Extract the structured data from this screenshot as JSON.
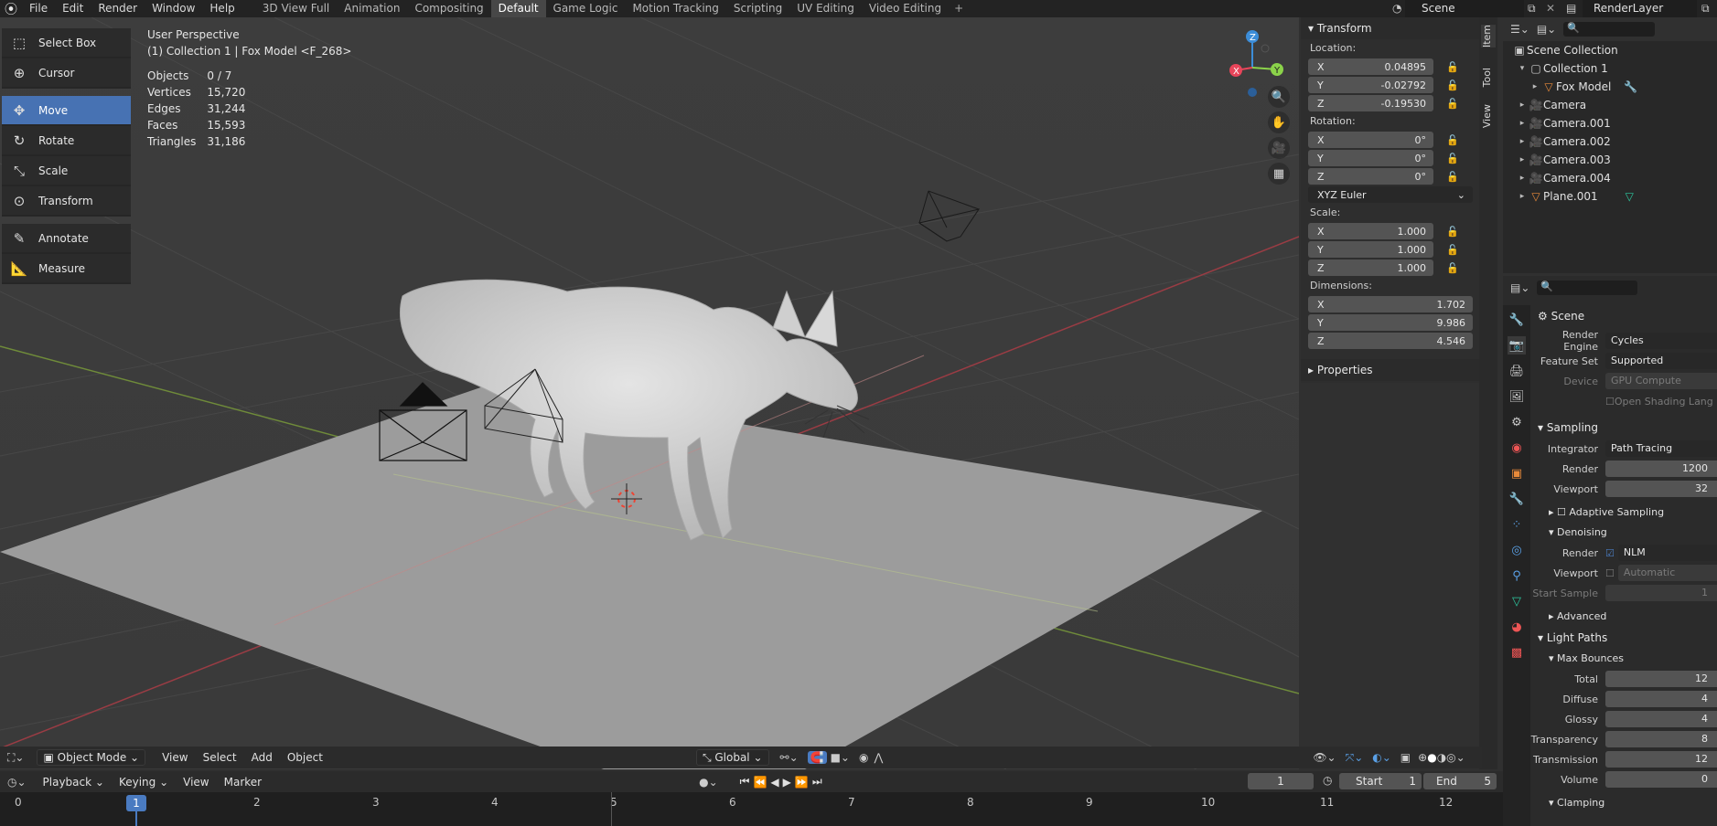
{
  "menu": [
    "File",
    "Edit",
    "Render",
    "Window",
    "Help"
  ],
  "workspaces": [
    "3D View Full",
    "Animation",
    "Compositing",
    "Default",
    "Game Logic",
    "Motion Tracking",
    "Scripting",
    "UV Editing",
    "Video Editing"
  ],
  "active_workspace": "Default",
  "scene_name": "Scene",
  "render_layer": "RenderLayer",
  "toolbar": [
    "Select Box",
    "Cursor",
    "Move",
    "Rotate",
    "Scale",
    "Transform",
    "Annotate",
    "Measure"
  ],
  "active_tool": "Move",
  "viewport": {
    "view_name": "User Perspective",
    "object_info": "(1) Collection 1 | Fox Model <F_268>",
    "stats": [
      {
        "label": "Objects",
        "value": "0 / 7"
      },
      {
        "label": "Vertices",
        "value": "15,720"
      },
      {
        "label": "Edges",
        "value": "31,244"
      },
      {
        "label": "Faces",
        "value": "15,593"
      },
      {
        "label": "Triangles",
        "value": "31,186"
      }
    ]
  },
  "npanel": {
    "transform_title": "Transform",
    "location_label": "Location:",
    "location": [
      {
        "axis": "X",
        "value": "0.04895"
      },
      {
        "axis": "Y",
        "value": "-0.02792"
      },
      {
        "axis": "Z",
        "value": "-0.19530"
      }
    ],
    "rotation_label": "Rotation:",
    "rotation": [
      {
        "axis": "X",
        "value": "0°"
      },
      {
        "axis": "Y",
        "value": "0°"
      },
      {
        "axis": "Z",
        "value": "0°"
      }
    ],
    "rotation_mode": "XYZ Euler",
    "scale_label": "Scale:",
    "scale": [
      {
        "axis": "X",
        "value": "1.000"
      },
      {
        "axis": "Y",
        "value": "1.000"
      },
      {
        "axis": "Z",
        "value": "1.000"
      }
    ],
    "dimensions_label": "Dimensions:",
    "dimensions": [
      {
        "axis": "X",
        "value": "1.702"
      },
      {
        "axis": "Y",
        "value": "9.986"
      },
      {
        "axis": "Z",
        "value": "4.546"
      }
    ],
    "properties_title": "Properties",
    "tabs": [
      "Item",
      "Tool",
      "View"
    ]
  },
  "outliner": {
    "root": "Scene Collection",
    "collection": "Collection 1",
    "items": [
      "Fox Model",
      "Camera",
      "Camera.001",
      "Camera.002",
      "Camera.003",
      "Camera.004",
      "Plane.001"
    ]
  },
  "properties": {
    "context": "Scene",
    "render_engine_label": "Render Engine",
    "render_engine": "Cycles",
    "feature_set_label": "Feature Set",
    "feature_set": "Supported",
    "device_label": "Device",
    "device": "GPU Compute",
    "osl_label": "Open Shading Lang",
    "sampling_title": "Sampling",
    "integrator_label": "Integrator",
    "integrator": "Path Tracing",
    "render_label": "Render",
    "render_samples": "1200",
    "viewport_label": "Viewport",
    "viewport_samples": "32",
    "adaptive_sampling": "Adaptive Sampling",
    "denoising": "Denoising",
    "denoise_render_label": "Render",
    "denoise_render": "NLM",
    "denoise_viewport_label": "Viewport",
    "denoise_viewport": "Automatic",
    "start_sample_label": "Start Sample",
    "start_sample": "1",
    "advanced": "Advanced",
    "light_paths_title": "Light Paths",
    "max_bounces": "Max Bounces",
    "bounces": [
      {
        "label": "Total",
        "value": "12"
      },
      {
        "label": "Diffuse",
        "value": "4"
      },
      {
        "label": "Glossy",
        "value": "4"
      },
      {
        "label": "Transparency",
        "value": "8"
      },
      {
        "label": "Transmission",
        "value": "12"
      },
      {
        "label": "Volume",
        "value": "0"
      }
    ],
    "clamping": "Clamping"
  },
  "header3d": {
    "mode": "Object Mode",
    "menus": [
      "View",
      "Select",
      "Add",
      "Object"
    ],
    "orientation": "Global"
  },
  "timeline": {
    "menus": [
      "Playback",
      "Keying",
      "View",
      "Marker"
    ],
    "current_frame": "1",
    "start_label": "Start",
    "start": "1",
    "end_label": "End",
    "end": "5",
    "ticks": [
      "0",
      "1",
      "2",
      "3",
      "4",
      "5",
      "6",
      "7",
      "8",
      "9",
      "10",
      "11",
      "12"
    ]
  },
  "colors": {
    "accent": "#4772b3",
    "axis_x": "#e8455a",
    "axis_y": "#8bd34a",
    "axis_z": "#3c8dd8"
  }
}
